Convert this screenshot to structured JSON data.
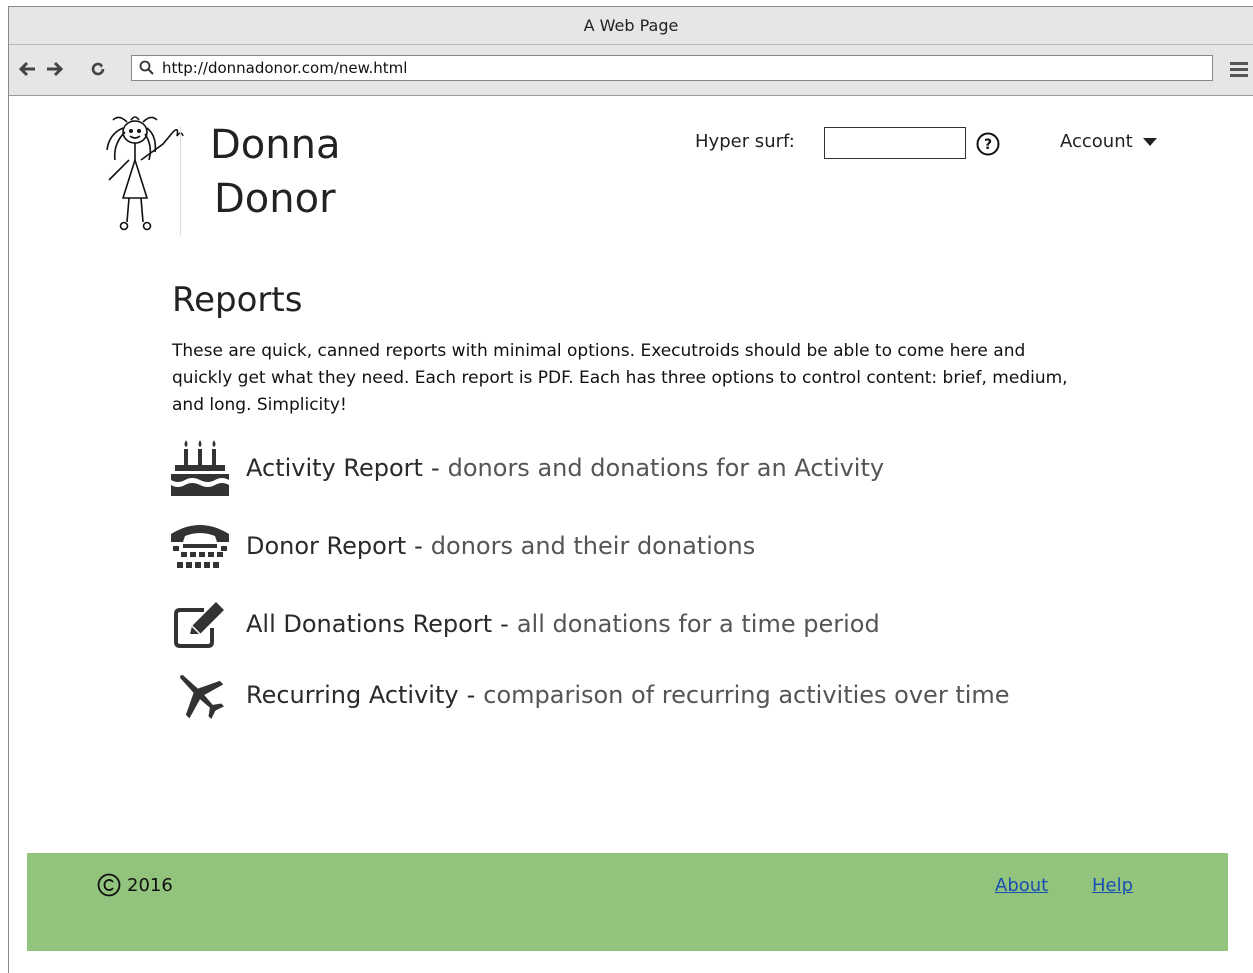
{
  "browser": {
    "title": "A Web Page",
    "url": "http://donnadonor.com/new.html"
  },
  "header": {
    "logo_line1": "Donna",
    "logo_line2": "Donor",
    "hyper_surf_label": "Hyper surf:",
    "hyper_surf_value": "",
    "account_label": "Account"
  },
  "reports": {
    "title": "Reports",
    "description": "These are quick, canned reports with minimal options. Executroids should be able to come here and quickly get what they need. Each report is PDF. Each has three options to control content: brief, medium, and long. Simplicity!",
    "separator": "-",
    "items": [
      {
        "icon": "birthday-cake-icon",
        "title": "Activity Report",
        "desc": "donors and donations for an Activity"
      },
      {
        "icon": "phone-icon",
        "title": "Donor Report",
        "desc": "donors and their donations"
      },
      {
        "icon": "edit-icon",
        "title": "All Donations Report",
        "desc": "all donations for a time period"
      },
      {
        "icon": "plane-icon",
        "title": "Recurring Activity",
        "desc": "comparison of recurring activities over time"
      }
    ]
  },
  "footer": {
    "copyright_year": "2016",
    "links": [
      "About",
      "Help"
    ]
  },
  "colors": {
    "footer_bg": "#92c47e",
    "link": "#1a4fb0",
    "chrome_bg": "#e6e6e6"
  }
}
